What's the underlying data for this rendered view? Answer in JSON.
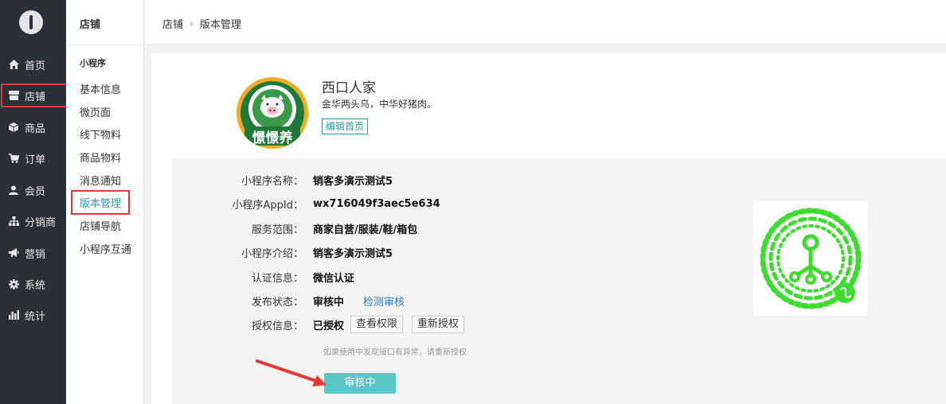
{
  "nav": {
    "items": [
      {
        "label": "首页",
        "icon": "home-icon"
      },
      {
        "label": "店铺",
        "icon": "store-icon"
      },
      {
        "label": "商品",
        "icon": "box-icon"
      },
      {
        "label": "订单",
        "icon": "cart-icon"
      },
      {
        "label": "会员",
        "icon": "user-icon"
      },
      {
        "label": "分销商",
        "icon": "sitemap-icon"
      },
      {
        "label": "营销",
        "icon": "megaphone-icon"
      },
      {
        "label": "系统",
        "icon": "gear-icon"
      },
      {
        "label": "统计",
        "icon": "bar-chart-icon"
      }
    ],
    "active": "店铺"
  },
  "subnav": {
    "title": "店铺",
    "group": "小程序",
    "items": [
      "基本信息",
      "微页面",
      "线下物料",
      "商品物料",
      "消息通知",
      "版本管理",
      "店铺导航",
      "小程序互通"
    ],
    "active": "版本管理"
  },
  "breadcrumb": {
    "root": "店铺",
    "current": "版本管理"
  },
  "shop": {
    "name": "西口人家",
    "desc": "金华两头乌，中华好猪肉。",
    "edit_label": "编辑首页",
    "logo_text": "憬憬养"
  },
  "info": {
    "name_label": "小程序名称：",
    "name_value": "销客多演示测试5",
    "appid_label": "小程序AppId：",
    "appid_value": "wx716049f3aec5e634",
    "scope_label": "服务范围：",
    "scope_value": "商家自营/服装/鞋/箱包",
    "intro_label": "小程序介绍：",
    "intro_value": "销客多演示测试5",
    "cert_label": "认证信息：",
    "cert_value": "微信认证",
    "status_label": "发布状态：",
    "status_value": "审核中",
    "status_link": "检测审核",
    "auth_label": "授权信息：",
    "auth_value": "已授权",
    "view_perm": "查看权限",
    "reauth": "重新授权",
    "hint": "如果使用中发现接口有异常，请重新授权",
    "review_button": "审核中"
  },
  "colors": {
    "nav_bg": "#2b2f37",
    "accent": "#2b9ba5",
    "button": "#57c8c5",
    "highlight": "#e53935",
    "qr": "#3ddc2f"
  }
}
